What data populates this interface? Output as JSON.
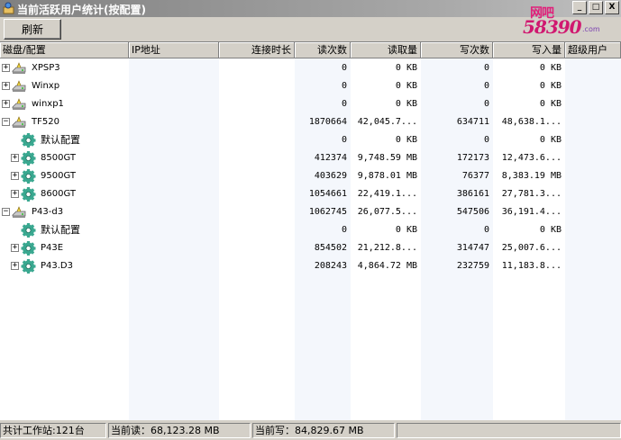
{
  "window": {
    "title": "当前活跃用户统计(按配置)",
    "controls": [
      "_",
      "□",
      "X"
    ]
  },
  "watermark": {
    "line1": "网吧",
    "line2": "58390",
    "line3": ".com"
  },
  "toolbar": {
    "refresh_label": "刷新"
  },
  "table": {
    "columns": [
      {
        "key": "name",
        "label": "磁盘/配置"
      },
      {
        "key": "ip",
        "label": "IP地址"
      },
      {
        "key": "duration",
        "label": "连接时长"
      },
      {
        "key": "reads",
        "label": "读次数"
      },
      {
        "key": "read_amount",
        "label": "读取量"
      },
      {
        "key": "writes",
        "label": "写次数"
      },
      {
        "key": "write_amount",
        "label": "写入量"
      },
      {
        "key": "superuser",
        "label": "超级用户"
      }
    ],
    "rows": [
      {
        "level": 0,
        "expander": "+",
        "icon": "disk-icon",
        "name": "XPSP3",
        "reads": "0",
        "read_amount": "0 KB",
        "writes": "0",
        "write_amount": "0 KB"
      },
      {
        "level": 0,
        "expander": "+",
        "icon": "disk-icon",
        "name": "Winxp",
        "reads": "0",
        "read_amount": "0 KB",
        "writes": "0",
        "write_amount": "0 KB"
      },
      {
        "level": 0,
        "expander": "+",
        "icon": "disk-icon",
        "name": "winxp1",
        "reads": "0",
        "read_amount": "0 KB",
        "writes": "0",
        "write_amount": "0 KB"
      },
      {
        "level": 0,
        "expander": "−",
        "icon": "disk-icon",
        "name": "TF520",
        "reads": "1870664",
        "read_amount": "42,045.7...",
        "writes": "634711",
        "write_amount": "48,638.1..."
      },
      {
        "level": 1,
        "expander": "",
        "icon": "gear-icon",
        "name": "默认配置",
        "cn": true,
        "reads": "0",
        "read_amount": "0 KB",
        "writes": "0",
        "write_amount": "0 KB"
      },
      {
        "level": 1,
        "expander": "+",
        "icon": "gear-icon",
        "name": "8500GT",
        "reads": "412374",
        "read_amount": "9,748.59 MB",
        "writes": "172173",
        "write_amount": "12,473.6..."
      },
      {
        "level": 1,
        "expander": "+",
        "icon": "gear-icon",
        "name": "9500GT",
        "reads": "403629",
        "read_amount": "9,878.01 MB",
        "writes": "76377",
        "write_amount": "8,383.19 MB"
      },
      {
        "level": 1,
        "expander": "+",
        "icon": "gear-icon",
        "name": "8600GT",
        "reads": "1054661",
        "read_amount": "22,419.1...",
        "writes": "386161",
        "write_amount": "27,781.3..."
      },
      {
        "level": 0,
        "expander": "−",
        "icon": "disk-icon",
        "name": "P43-d3",
        "reads": "1062745",
        "read_amount": "26,077.5...",
        "writes": "547506",
        "write_amount": "36,191.4..."
      },
      {
        "level": 1,
        "expander": "",
        "icon": "gear-icon",
        "name": "默认配置",
        "cn": true,
        "reads": "0",
        "read_amount": "0 KB",
        "writes": "0",
        "write_amount": "0 KB"
      },
      {
        "level": 1,
        "expander": "+",
        "icon": "gear-icon",
        "name": "P43E",
        "reads": "854502",
        "read_amount": "21,212.8...",
        "writes": "314747",
        "write_amount": "25,007.6..."
      },
      {
        "level": 1,
        "expander": "+",
        "icon": "gear-icon",
        "name": "P43.D3",
        "reads": "208243",
        "read_amount": "4,864.72 MB",
        "writes": "232759",
        "write_amount": "11,183.8..."
      }
    ]
  },
  "status": {
    "workstations": "共计工作站:121台",
    "current_read": "当前读：68,123.28 MB",
    "current_write": "当前写：84,829.67 MB"
  }
}
